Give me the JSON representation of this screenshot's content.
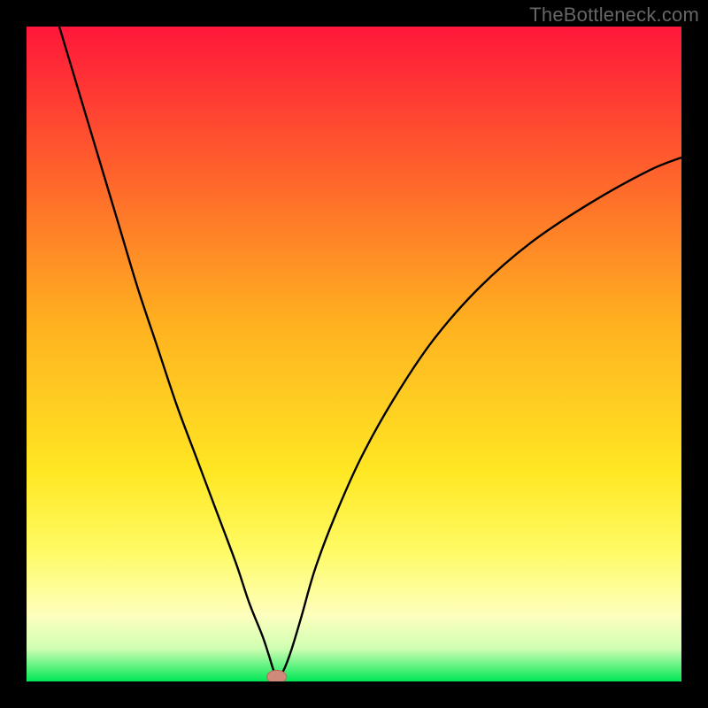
{
  "watermark": "TheBottleneck.com",
  "colors": {
    "black": "#000000",
    "curve": "#000000",
    "marker_fill": "#cf8a7a",
    "marker_stroke": "#b76a5c"
  },
  "chart_data": {
    "type": "line",
    "title": "",
    "xlabel": "",
    "ylabel": "",
    "xlim": [
      0,
      100
    ],
    "ylim": [
      0,
      100
    ],
    "grid": false,
    "legend": false,
    "gradient_stops": [
      {
        "offset": 0.0,
        "color": "#ff173a"
      },
      {
        "offset": 0.2,
        "color": "#ff5a2d"
      },
      {
        "offset": 0.45,
        "color": "#ffb020"
      },
      {
        "offset": 0.68,
        "color": "#ffe723"
      },
      {
        "offset": 0.8,
        "color": "#fffb64"
      },
      {
        "offset": 0.9,
        "color": "#fdffbe"
      },
      {
        "offset": 0.95,
        "color": "#cfffb2"
      },
      {
        "offset": 1.0,
        "color": "#00e756"
      }
    ],
    "series": [
      {
        "name": "bottleneck-curve",
        "x": [
          5,
          8,
          11,
          14,
          17,
          20,
          23,
          26,
          29,
          32,
          34,
          36,
          37,
          37.8,
          38.5,
          39.3,
          40.5,
          42,
          44,
          47,
          51,
          56,
          62,
          69,
          77,
          86,
          95,
          100
        ],
        "values": [
          100,
          90,
          80,
          70,
          60,
          51,
          42,
          34,
          26,
          18,
          12,
          7,
          4,
          1.5,
          0.7,
          1.8,
          5,
          10,
          17,
          25,
          34,
          43,
          52,
          60,
          67,
          73,
          78,
          80
        ]
      }
    ],
    "marker": {
      "x": 38.2,
      "y": 0.7,
      "rx": 1.5,
      "ry": 1.0
    }
  }
}
